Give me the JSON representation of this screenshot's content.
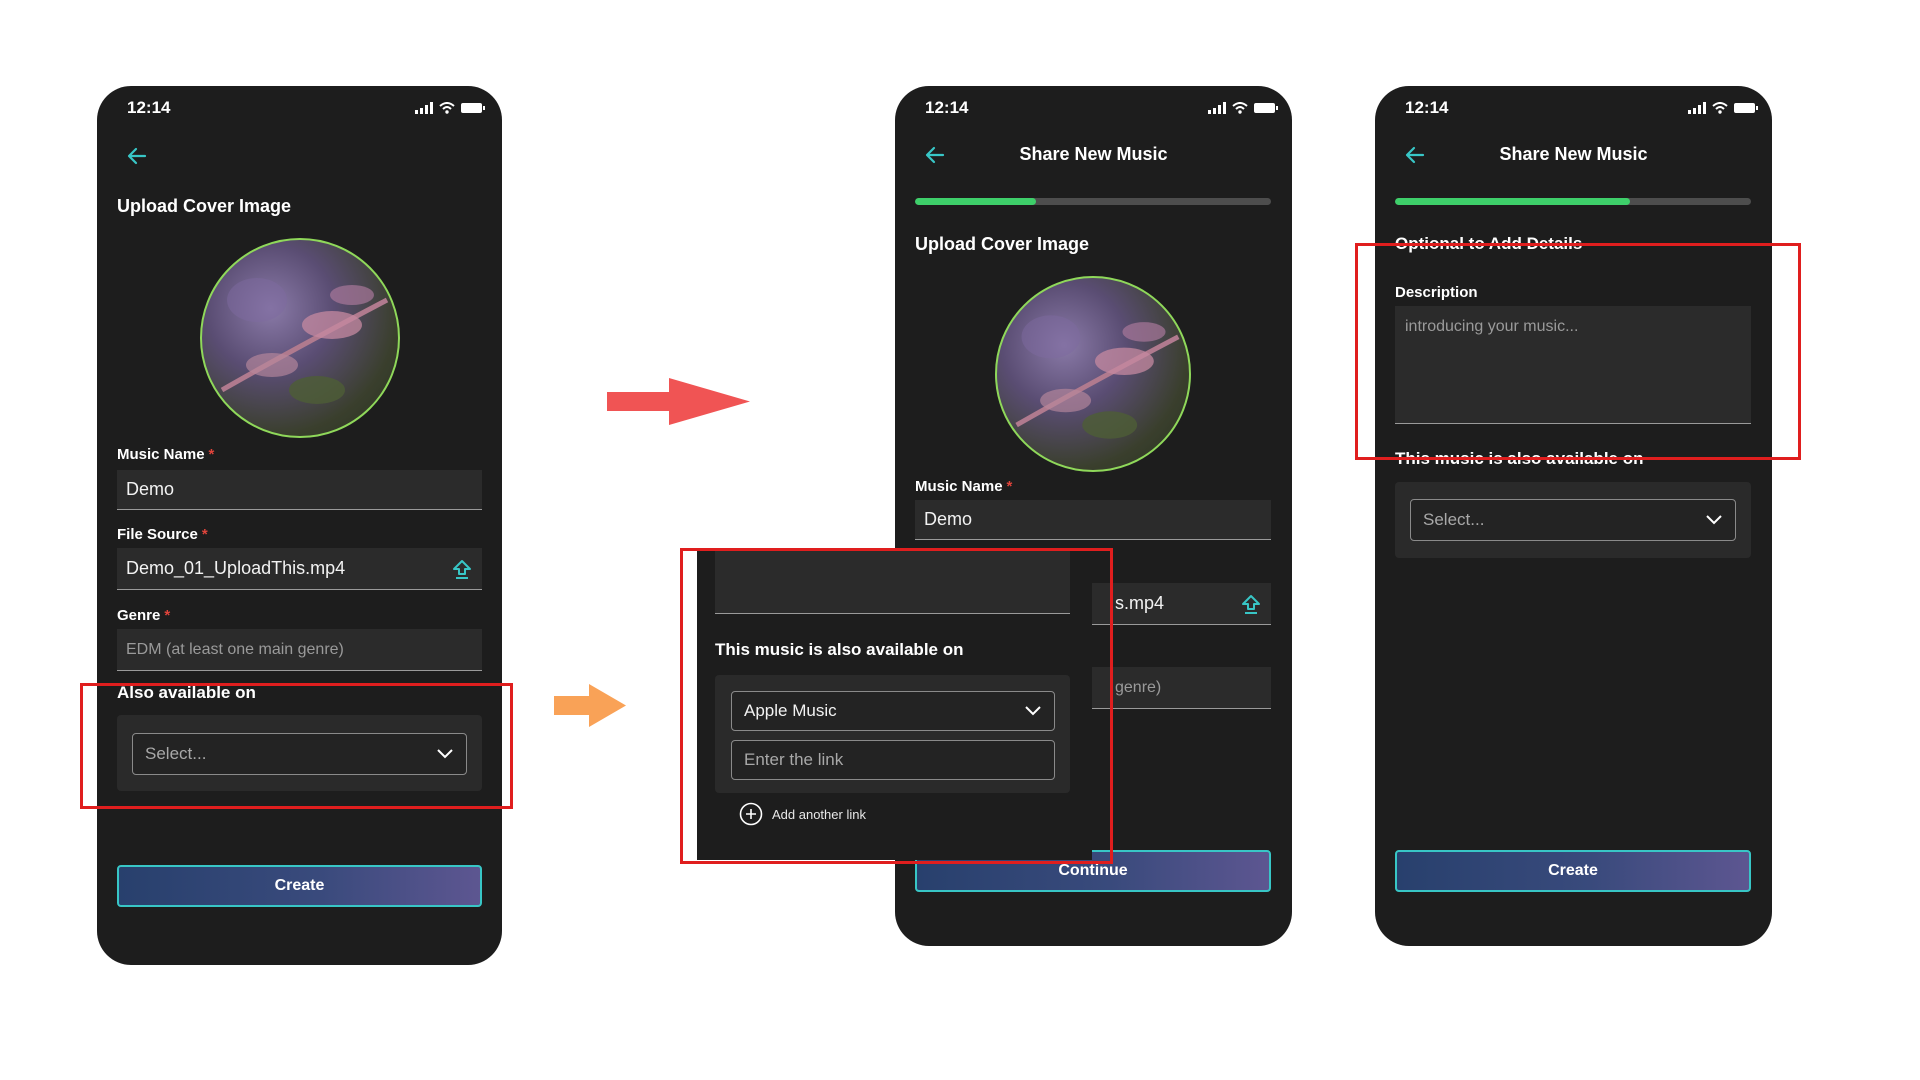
{
  "phone1": {
    "time": "12:14",
    "section_title": "Upload Cover Image",
    "music_name_label": "Music Name",
    "music_name_value": "Demo",
    "file_source_label": "File Source",
    "file_source_value": "Demo_01_UploadThis.mp4",
    "genre_label": "Genre",
    "genre_placeholder": "EDM (at least one main genre)",
    "also_label": "Also available on",
    "select_placeholder": "Select...",
    "create_label": "Create"
  },
  "phone2": {
    "time": "12:14",
    "title": "Share New Music",
    "progress": 0.34,
    "section_title": "Upload Cover Image",
    "music_name_label": "Music Name",
    "music_name_value": "Demo",
    "file_fragment": "s.mp4",
    "genre_fragment": "genre)",
    "continue_label": "Continue"
  },
  "overlay": {
    "available_title": "This music is also available on",
    "platform": "Apple Music",
    "link_placeholder": "Enter the link",
    "add_link": "Add another link"
  },
  "phone3": {
    "time": "12:14",
    "title": "Share New Music",
    "progress": 0.66,
    "optional_title": "Optional to Add Details",
    "description_label": "Description",
    "description_placeholder": "introducing your music...",
    "available_label": "This music is also available on",
    "select_placeholder": "Select...",
    "create_label": "Create"
  },
  "colors": {
    "accent": "#38c6c6",
    "progress": "#3ecf6a",
    "highlight": "#e01e1e",
    "arrow_red": "#f05454",
    "arrow_orange": "#f9a257",
    "required": "#e0443b"
  }
}
